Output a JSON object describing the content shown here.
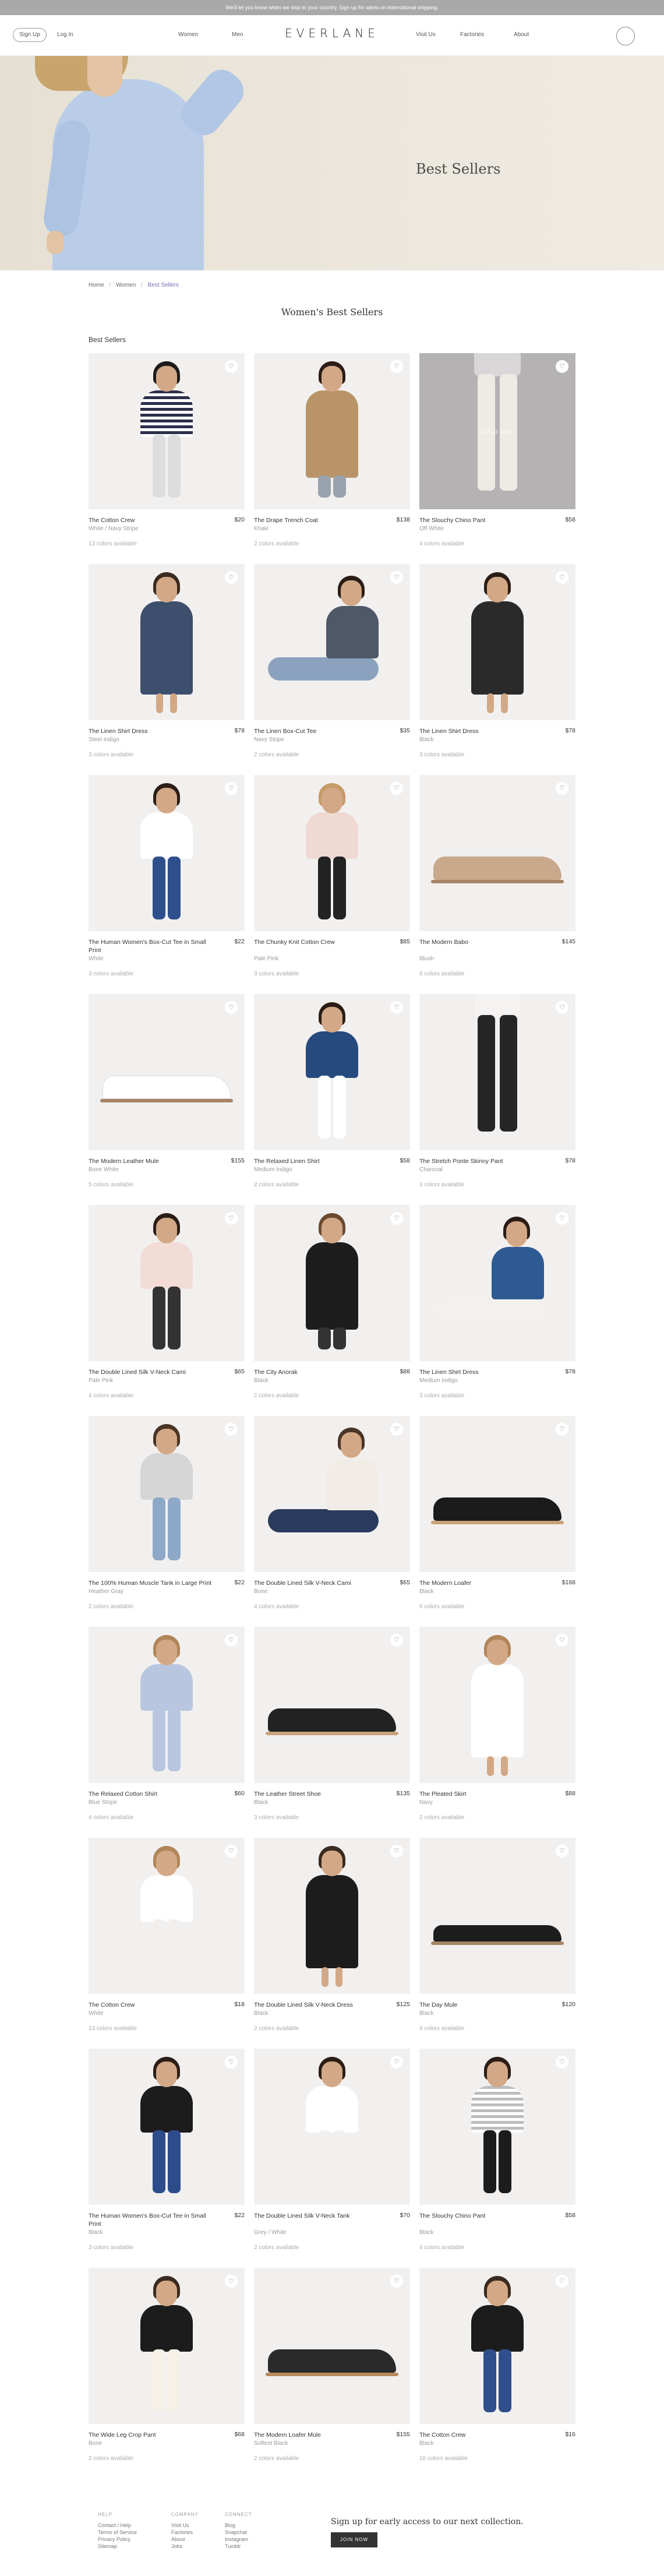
{
  "announcement": "We'll let you know when we ship to your country. Sign up for alerts on international shipping.",
  "nav": {
    "signup_label": "Sign Up",
    "login_label": "Log In",
    "left_links": [
      "Women",
      "Men"
    ],
    "logo": "EVERLANE",
    "right_links": [
      "Visit Us",
      "Factories",
      "About"
    ]
  },
  "hero": {
    "title": "Best Sellers"
  },
  "breadcrumb": [
    "Home",
    "Women",
    "Best Sellers"
  ],
  "page_title": "Women's Best Sellers",
  "section_label": "Best Sellers",
  "products": [
    {
      "name": "The Cotton Crew",
      "price": "$20",
      "color": "White / Navy Stripe",
      "avail": "13 colors available"
    },
    {
      "name": "The Drape Trench Coat",
      "price": "$138",
      "color": "Khaki",
      "avail": "2 colors available"
    },
    {
      "name": "The Slouchy Chino Pant",
      "price": "$58",
      "color": "Off-White",
      "avail": "4 colors available",
      "sold_out": "SOLD OUT"
    },
    {
      "name": "The Linen Shirt Dress",
      "price": "$78",
      "color": "Steel Indigo",
      "avail": "3 colors available"
    },
    {
      "name": "The Linen Box-Cut Tee",
      "price": "$35",
      "color": "Navy Stripe",
      "avail": "2 colors available"
    },
    {
      "name": "The Linen Shirt Dress",
      "price": "$78",
      "color": "Black",
      "avail": "3 colors available"
    },
    {
      "name": "The Human Women's Box-Cut Tee in Small Print",
      "price": "$22",
      "color": "White",
      "avail": "3 colors available"
    },
    {
      "name": "The Chunky Knit Cotton Crew",
      "price": "$85",
      "color": "Pale Pink",
      "avail": "3 colors available"
    },
    {
      "name": "The Modern Babo",
      "price": "$145",
      "color": "Blush",
      "avail": "6 colors available"
    },
    {
      "name": "The Modern Leather Mule",
      "price": "$155",
      "color": "Bone White",
      "avail": "5 colors available"
    },
    {
      "name": "The Relaxed Linen Shirt",
      "price": "$58",
      "color": "Medium Indigo",
      "avail": "2 colors available"
    },
    {
      "name": "The Stretch Ponte Skinny Pant",
      "price": "$78",
      "color": "Charcoal",
      "avail": "3 colors available"
    },
    {
      "name": "The Double Lined Silk V-Neck Cami",
      "price": "$65",
      "color": "Pale Pink",
      "avail": "4 colors available"
    },
    {
      "name": "The City Anorak",
      "price": "$88",
      "color": "Black",
      "avail": "2 colors available"
    },
    {
      "name": "The Linen Shirt Dress",
      "price": "$78",
      "color": "Medium Indigo",
      "avail": "3 colors available"
    },
    {
      "name": "The 100% Human Muscle Tank in Large Print",
      "price": "$22",
      "color": "Heather Gray",
      "avail": "2 colors available"
    },
    {
      "name": "The Double Lined Silk V-Neck Cami",
      "price": "$65",
      "color": "Bone",
      "avail": "4 colors available"
    },
    {
      "name": "The Modern Loafer",
      "price": "$168",
      "color": "Black",
      "avail": "6 colors available"
    },
    {
      "name": "The Relaxed Cotton Shirt",
      "price": "$60",
      "color": "Blue Stripe",
      "avail": "4 colors available"
    },
    {
      "name": "The Leather Street Shoe",
      "price": "$135",
      "color": "Black",
      "avail": "3 colors available"
    },
    {
      "name": "The Pleated Skirt",
      "price": "$88",
      "color": "Navy",
      "avail": "2 colors available"
    },
    {
      "name": "The Cotton Crew",
      "price": "$18",
      "color": "White",
      "avail": "13 colors available"
    },
    {
      "name": "The Double Lined Silk V-Neck Dress",
      "price": "$125",
      "color": "Black",
      "avail": "2 colors available"
    },
    {
      "name": "The Day Mule",
      "price": "$120",
      "color": "Black",
      "avail": "4 colors available"
    },
    {
      "name": "The Human Women's Box-Cut Tee in Small Print",
      "price": "$22",
      "color": "Black",
      "avail": "3 colors available"
    },
    {
      "name": "The Double Lined Silk V-Neck Tank",
      "price": "$70",
      "color": "Grey / White",
      "avail": "2 colors available"
    },
    {
      "name": "The Slouchy Chino Pant",
      "price": "$58",
      "color": "Black",
      "avail": "4 colors available"
    },
    {
      "name": "The Wide Leg Crop Pant",
      "price": "$68",
      "color": "Bone",
      "avail": "2 colors available"
    },
    {
      "name": "The Modern Loafer Mule",
      "price": "$155",
      "color": "Softest Black",
      "avail": "2 colors available"
    },
    {
      "name": "The Cotton Crew",
      "price": "$16",
      "color": "Black",
      "avail": "10 colors available"
    }
  ],
  "footer": {
    "columns": [
      {
        "heading": "HELP",
        "links": [
          "Contact / Help",
          "Terms of Service",
          "Privacy Policy",
          "Sitemap"
        ]
      },
      {
        "heading": "COMPANY",
        "links": [
          "Visit Us",
          "Factories",
          "About",
          "Jobs"
        ]
      },
      {
        "heading": "CONNECT",
        "links": [
          "Blog",
          "Snapchat",
          "Instagram",
          "Tumblr"
        ]
      }
    ],
    "signup_text": "Sign up for early access to our next collection.",
    "join_label": "JOIN NOW"
  },
  "colors": {
    "announcement_bg": "#a9a9a9",
    "breadcrumb_current": "#7a6ab8",
    "hero_bg": "#e8e3d9"
  }
}
